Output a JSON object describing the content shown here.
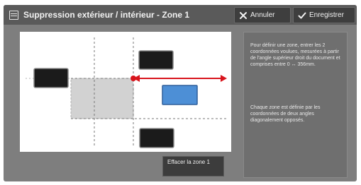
{
  "header": {
    "title": "Suppression extérieur / intérieur - Zone 1",
    "cancel_label": "Annuler",
    "save_label": "Enregistrer",
    "title_icon": "list-icon",
    "cancel_icon": "close-icon",
    "save_icon": "checkmark-icon"
  },
  "info": {
    "paragraph1": "Pour définir une zone, entrer les 2 coordonnées voulues, mesurées à partir de l'angle supérieur droit du document et comprises entre 0 ↔ 356mm.",
    "paragraph2": "Chaque zone est définie par les coordonnées de deux angles diagonalement opposés."
  },
  "actions": {
    "clear_zone_label": "Effacer la zone 1"
  },
  "colors": {
    "frame": "#7e7e7e",
    "titlebar": "#5a5a5a",
    "accent_red": "#d8141c",
    "highlight_blue": "#4d8fd6",
    "zone_gray": "#d2d2d2"
  }
}
